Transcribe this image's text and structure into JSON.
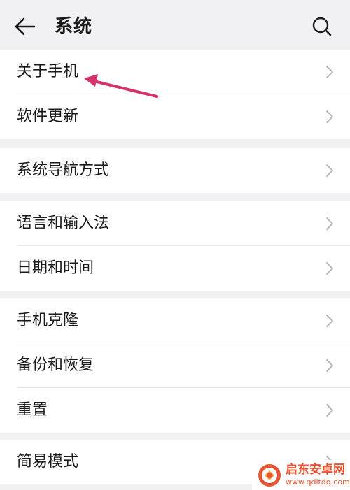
{
  "header": {
    "title": "系统",
    "back_icon": "arrow-left-icon",
    "search_icon": "search-icon"
  },
  "groups": [
    {
      "items": [
        {
          "label": "关于手机"
        },
        {
          "label": "软件更新"
        }
      ]
    },
    {
      "items": [
        {
          "label": "系统导航方式"
        }
      ]
    },
    {
      "items": [
        {
          "label": "语言和输入法"
        },
        {
          "label": "日期和时间"
        }
      ]
    },
    {
      "items": [
        {
          "label": "手机克隆"
        },
        {
          "label": "备份和恢复"
        },
        {
          "label": "重置"
        }
      ]
    },
    {
      "items": [
        {
          "label": "简易模式"
        }
      ]
    }
  ],
  "annotation": {
    "type": "arrow",
    "color": "#d6336c",
    "points_to": "关于手机"
  },
  "watermark": {
    "name": "启东安卓网",
    "url": "www.qdltdq.com",
    "color": "#e8542f"
  },
  "colors": {
    "background": "#f1f1f3",
    "card": "#ffffff",
    "chevron": "#b8b8b8"
  }
}
